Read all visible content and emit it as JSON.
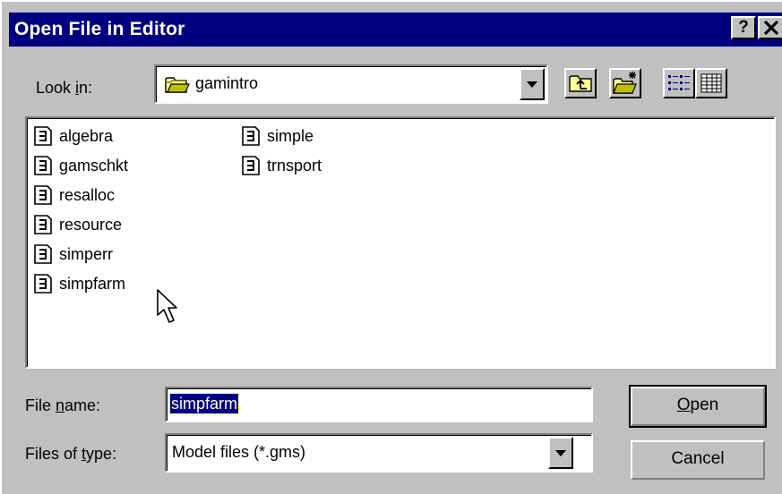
{
  "dialog": {
    "title": "Open File in Editor",
    "help_button": "?",
    "close_button": "✕"
  },
  "look_in": {
    "label_pre": "Look ",
    "label_accel": "i",
    "label_post": "n:",
    "value": "gamintro",
    "icon": "folder-icon"
  },
  "toolbar": {
    "up_one_level": "up-folder-icon",
    "new_folder": "new-folder-icon",
    "list_view": "list-view-icon",
    "details_view": "details-view-icon"
  },
  "files": {
    "column1": [
      "algebra",
      "gamschkt",
      "resalloc",
      "resource",
      "simperr",
      "simpfarm"
    ],
    "column2": [
      "simple",
      "trnsport"
    ]
  },
  "file_name": {
    "label_pre": "File ",
    "label_accel": "n",
    "label_post": "ame:",
    "value": "simpfarm"
  },
  "files_of_type": {
    "label_pre": "Files of ",
    "label_accel": "t",
    "label_post": "ype:",
    "value": "Model files (*.gms)"
  },
  "buttons": {
    "open_accel": "O",
    "open_rest": "pen",
    "cancel": "Cancel"
  },
  "colors": {
    "titlebar": "#000080",
    "face": "#c0c0c0",
    "selection": "#000080"
  }
}
